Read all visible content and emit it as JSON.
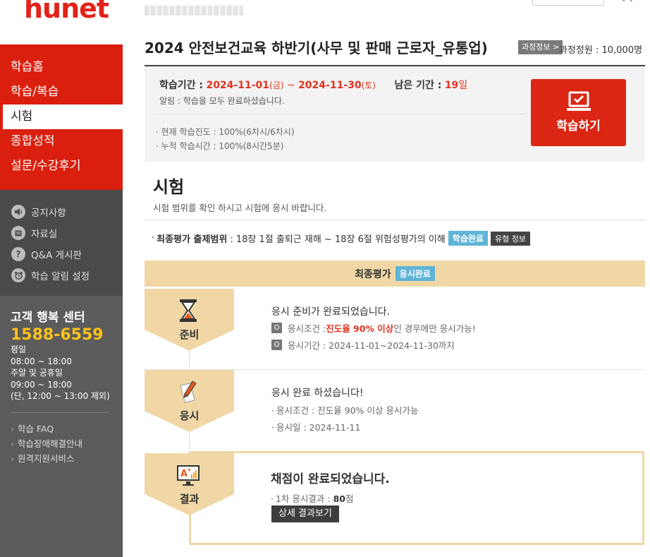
{
  "sidebar": {
    "logo": "hunet",
    "menu": [
      {
        "label": "학습홈"
      },
      {
        "label": "학습/복습"
      },
      {
        "label": "시험"
      },
      {
        "label": "종합성적"
      },
      {
        "label": "설문/수강후기"
      }
    ],
    "sub_menu": [
      {
        "label": "공지사항",
        "icon": "speaker-icon"
      },
      {
        "label": "자료실",
        "icon": "folder-icon"
      },
      {
        "label": "Q&A 게시판",
        "icon": "question-icon"
      },
      {
        "label": "학습 알림 설정",
        "icon": "alarm-clock-icon"
      }
    ],
    "customer_center": {
      "title": "고객 행복 센터",
      "phone": "1588-6559",
      "hours": [
        "평일",
        "08:00 ~ 18:00",
        "주말 및 공휴일",
        "09:00 ~ 18:00",
        "(단, 12:00 ~ 13:00 제외)"
      ],
      "links": [
        "학습 FAQ",
        "학습장애해결안내",
        "원격지원서비스"
      ]
    }
  },
  "course": {
    "title": "2024 안전보건교육 하반기(사무 및 판매 근로자_유통업)",
    "info_button": "과정정보 >",
    "capacity": "과정정원 : 10,000명",
    "period_label": "학습기간 :",
    "period_start": "2024-11-01",
    "period_start_day": "(금)",
    "period_sep": "~",
    "period_end": "2024-11-30",
    "period_end_day": "(토)",
    "remaining_label": "남은 기간 :",
    "remaining_value": "19",
    "remaining_unit": "일",
    "notice": "알림 : 학습을 모두 완료하셨습니다.",
    "progress": "· 현재 학습진도 : 100%(6차시/6차시)",
    "study_time": "· 누적 학습시간 : 100%(8시간5분)",
    "study_button": "학습하기"
  },
  "exam": {
    "title": "시험",
    "description": "시험 범위를 확인 하시고 시험에 응시 바랍니다.",
    "range_label": "최종평가 출제범위",
    "range_text": ": 18장 1절 출퇴근 재해 ~ 18장 6절 위험성평가의 이해",
    "range_status": "학습완료",
    "type_button": "유형 정보",
    "final_label": "최종평가",
    "final_status": "응시완료",
    "steps": {
      "prepare": {
        "label": "준비",
        "heading": "응시 준비가 완료되었습니다.",
        "condition_prefix": "응시조건 : ",
        "condition_highlight": "진도율 90% 이상",
        "condition_suffix": "인 경우에만 응시가능!",
        "period": "응시기간 : 2024-11-01~2024-11-30까지",
        "bullet": "O"
      },
      "take": {
        "label": "응시",
        "heading": "응시 완료 하셨습니다!",
        "condition": "응시조건 : 진도율 90% 이상 응시가능",
        "date": "응시일 : 2024-11-11"
      },
      "result": {
        "label": "결과",
        "heading": "채점이 완료되었습니다.",
        "score_prefix": "1차 응시결과 : ",
        "score_value": "80",
        "score_unit": "점",
        "detail_button": "상세 결과보기"
      }
    }
  },
  "colors": {
    "brand_red": "#da1f0e",
    "accent_blue": "#5fb4d8",
    "step_beige": "#f0d7a5",
    "phone_yellow": "#ffc21a"
  }
}
